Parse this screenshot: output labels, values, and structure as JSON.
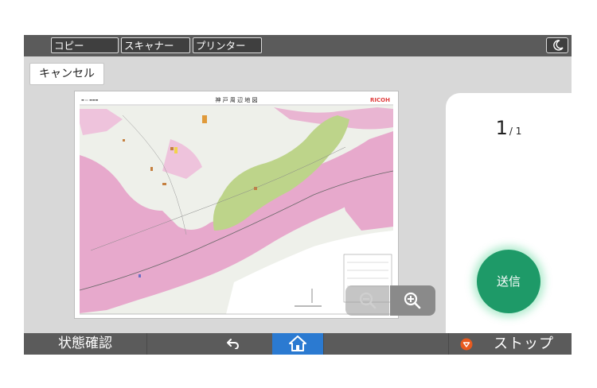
{
  "top_tabs": [
    {
      "label": "コピー"
    },
    {
      "label": "スキャナー"
    },
    {
      "label": "プリンター"
    }
  ],
  "cancel_label": "キャンセル",
  "preview": {
    "map_title": "神 戸 周 辺 地 図",
    "brand": "RICOH"
  },
  "page_counter": {
    "current": "1",
    "total": "/ 1"
  },
  "send_label": "送信",
  "bottom_bar": {
    "status_label": "状態確認",
    "stop_label": "ストップ"
  },
  "colors": {
    "send": "#1e9a68",
    "home": "#2b7ad1",
    "stop": "#e85a1f",
    "bar": "#5b5b5b"
  },
  "icons": [
    "moon-icon",
    "zoom-out-icon",
    "zoom-in-icon",
    "back-arrow-icon",
    "home-icon",
    "stop-icon"
  ]
}
